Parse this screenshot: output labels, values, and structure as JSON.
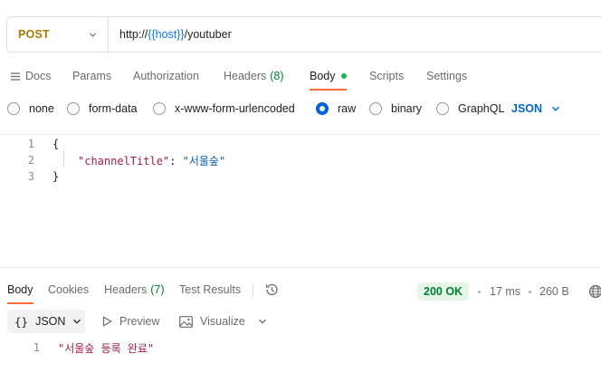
{
  "request": {
    "method": "POST",
    "url_prefix": "http://",
    "url_variable": "{{host}}",
    "url_path": "/youtuber"
  },
  "request_tabs": [
    {
      "label": "Docs"
    },
    {
      "label": "Params"
    },
    {
      "label": "Authorization"
    },
    {
      "label": "Headers",
      "count": "(8)"
    },
    {
      "label": "Body",
      "active": true
    },
    {
      "label": "Scripts"
    },
    {
      "label": "Settings"
    }
  ],
  "body_types": {
    "options": [
      "none",
      "form-data",
      "x-www-form-urlencoded",
      "raw",
      "binary",
      "GraphQL"
    ],
    "selected": "raw",
    "format": "JSON"
  },
  "request_body": {
    "lines": [
      {
        "num": "1",
        "text": "{"
      },
      {
        "num": "2",
        "key": "\"channelTitle\"",
        "sep": ": ",
        "value": "\"서울숲\""
      },
      {
        "num": "3",
        "text": "}"
      }
    ]
  },
  "response_tabs": [
    {
      "label": "Body",
      "active": true
    },
    {
      "label": "Cookies"
    },
    {
      "label": "Headers",
      "count": "(7)"
    },
    {
      "label": "Test Results"
    }
  ],
  "response_meta": {
    "status": "200 OK",
    "time": "17 ms",
    "size": "260 B"
  },
  "response_toolbar": {
    "format": "JSON",
    "preview": "Preview",
    "visualize": "Visualize"
  },
  "response_body": {
    "lines": [
      {
        "num": "1",
        "text": "\"서울숲 등록 완료\""
      }
    ]
  },
  "colors": {
    "method": "#ad7a03",
    "accent": "#ff6c37",
    "variable": "#097bed",
    "count": "#007f31",
    "status_bg": "#e6f7ea",
    "radio_selected": "#0265d2"
  }
}
